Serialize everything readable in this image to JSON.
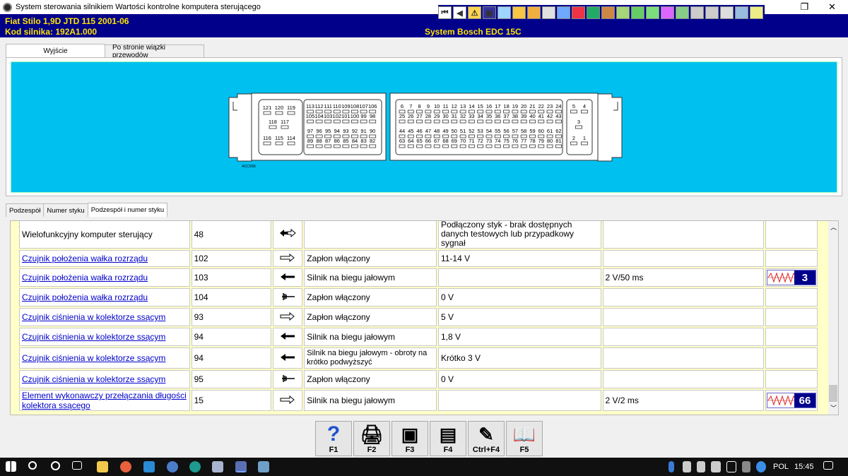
{
  "window": {
    "title": "System sterowania silnikiem  Wartości kontrolne komputera sterującego",
    "restore_glyph": "❐",
    "close_glyph": "✕"
  },
  "toolbar_icons": [
    "first-icon",
    "prev-icon",
    "warning-icon",
    "ecu-icon",
    "measure-icon",
    "gear-icon",
    "tools-icon",
    "clock-icon",
    "chart-icon",
    "car-icon",
    "doc-icon",
    "person-icon",
    "check-icon",
    "user-icon",
    "screen-icon",
    "graph-icon",
    "ecu2-icon",
    "inject-icon",
    "settings-icon",
    "warning2-icon",
    "calc-icon",
    "note-icon"
  ],
  "info": {
    "vehicle": "Fiat   Stilo  1,9D JTD 115 2001-06",
    "engine_code": "Kod silnika: 192A1.000",
    "system": "System Bosch EDC 15C"
  },
  "tabs_top": [
    "Wyjście",
    "Po stronie wiązki przewodów"
  ],
  "tabs_bottom": [
    "Podzespół",
    "Numer styku",
    "Podzespół i numer styku"
  ],
  "diagram": {
    "label": "ACC9S6",
    "left_top": [
      "121",
      "120",
      "119"
    ],
    "left_mid": [
      "118",
      "117"
    ],
    "left_bot": [
      "116",
      "115",
      "114"
    ],
    "mid1": [
      "113",
      "112",
      "111",
      "110",
      "109",
      "108",
      "107",
      "106"
    ],
    "mid2": [
      "105",
      "104",
      "103",
      "102",
      "101",
      "100",
      "99",
      "98"
    ],
    "mid3": [
      "97",
      "96",
      "95",
      "94",
      "93",
      "92",
      "91",
      "90"
    ],
    "mid4": [
      "89",
      "88",
      "87",
      "86",
      "85",
      "84",
      "83",
      "82"
    ],
    "r1": [
      "6",
      "7",
      "8",
      "9",
      "10",
      "11",
      "12",
      "13",
      "14",
      "15",
      "16",
      "17",
      "18",
      "19",
      "20",
      "21",
      "22",
      "23",
      "24"
    ],
    "r2": [
      "25",
      "26",
      "27",
      "28",
      "29",
      "30",
      "31",
      "32",
      "33",
      "34",
      "35",
      "36",
      "37",
      "38",
      "39",
      "40",
      "41",
      "42",
      "43"
    ],
    "r3": [
      "44",
      "45",
      "46",
      "47",
      "48",
      "49",
      "50",
      "51",
      "52",
      "53",
      "54",
      "55",
      "56",
      "57",
      "58",
      "59",
      "60",
      "61",
      "62"
    ],
    "r4": [
      "63",
      "64",
      "65",
      "66",
      "67",
      "68",
      "69",
      "70",
      "71",
      "72",
      "73",
      "74",
      "75",
      "76",
      "77",
      "78",
      "79",
      "80",
      "81"
    ],
    "side_top": [
      "5",
      "4"
    ],
    "side_mid": [
      "3"
    ],
    "side_bot": [
      "2",
      "1"
    ]
  },
  "rows": [
    {
      "component": "Wielofunkcyjny komputer sterujący",
      "link": false,
      "pin": "48",
      "arrow": "bidir",
      "condition": "",
      "value": "Podłączony styk - brak dostępnych danych testowych lub przypadkowy sygnał",
      "scope": "",
      "osc": ""
    },
    {
      "component": "Czujnik położenia wałka rozrządu",
      "link": true,
      "pin": "102",
      "arrow": "right",
      "condition": "Zapłon włączony",
      "value": "11-14 V",
      "scope": "",
      "osc": ""
    },
    {
      "component": "Czujnik położenia wałka rozrządu",
      "link": true,
      "pin": "103",
      "arrow": "left",
      "condition": "Silnik na biegu jałowym",
      "value": "",
      "scope": "2 V/50 ms",
      "osc": "3"
    },
    {
      "component": "Czujnik położenia wałka rozrządu",
      "link": true,
      "pin": "104",
      "arrow": "ground",
      "condition": "Zapłon włączony",
      "value": "0 V",
      "scope": "",
      "osc": ""
    },
    {
      "component": "Czujnik ciśnienia w kolektorze ssącym",
      "link": true,
      "pin": "93",
      "arrow": "right",
      "condition": "Zapłon włączony",
      "value": "5 V",
      "scope": "",
      "osc": ""
    },
    {
      "component": "Czujnik ciśnienia w kolektorze ssącym",
      "link": true,
      "pin": "94",
      "arrow": "left",
      "condition": "Silnik na biegu jałowym",
      "value": "1,8 V",
      "scope": "",
      "osc": ""
    },
    {
      "component": "Czujnik ciśnienia w kolektorze ssącym",
      "link": true,
      "pin": "94",
      "arrow": "left",
      "condition": "Silnik na biegu jałowym - obroty na krótko podwyższyć",
      "value": "Krótko 3 V",
      "scope": "",
      "osc": ""
    },
    {
      "component": "Czujnik ciśnienia w kolektorze ssącym",
      "link": true,
      "pin": "95",
      "arrow": "ground",
      "condition": "Zapłon włączony",
      "value": "0 V",
      "scope": "",
      "osc": ""
    },
    {
      "component": "Element wykonawczy przełączania długości kolektora ssącego",
      "link": true,
      "pin": "15",
      "arrow": "right",
      "condition": "Silnik na biegu jałowym",
      "value": "",
      "scope": "2 V/2 ms",
      "osc": "66"
    }
  ],
  "fkeys": [
    {
      "label": "F1",
      "icon": "help-icon",
      "glyph": "?"
    },
    {
      "label": "F2",
      "icon": "printer-icon",
      "glyph": "🖨"
    },
    {
      "label": "F3",
      "icon": "screen-print-icon",
      "glyph": "▣"
    },
    {
      "label": "F4",
      "icon": "screen-copy-icon",
      "glyph": "▤"
    },
    {
      "label": "Ctrl+F4",
      "icon": "notes-icon",
      "glyph": "✎"
    },
    {
      "label": "F5",
      "icon": "book-icon",
      "glyph": "📖"
    }
  ],
  "taskbar": {
    "lang": "POL",
    "time": "15:45"
  },
  "colors": {
    "title_blue": "#00008b",
    "info_yellow": "#ffe400",
    "diagram_cyan": "#00c0f0",
    "table_bg": "#ffffc8",
    "link_blue": "#0000cc"
  }
}
